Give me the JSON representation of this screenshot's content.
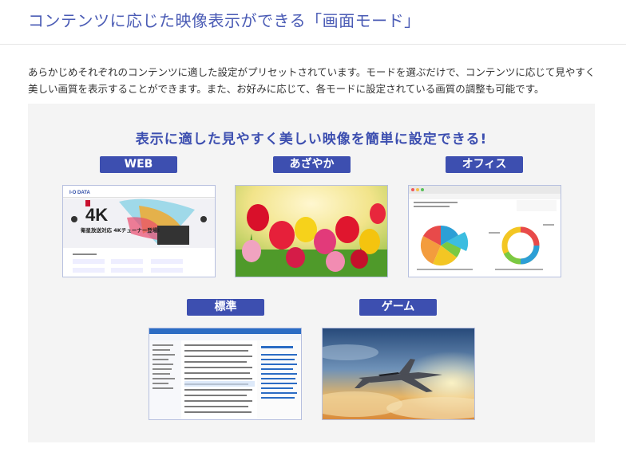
{
  "page": {
    "title": "コンテンツに応じた映像表示ができる「画面モード」",
    "intro": "あらかじめそれぞれのコンテンツに適した設定がプリセットされています。モードを選ぶだけで、コンテンツに応じて見やすく美しい画質を表示することができます。また、お好みに応じて、各モードに設定されている画質の調整も可能です。"
  },
  "panel": {
    "headline": "表示に適した見やすく美しい映像を簡単に設定できる!",
    "modes": [
      {
        "label": "WEB"
      },
      {
        "label": "あざやか"
      },
      {
        "label": "オフィス"
      },
      {
        "label": "標準"
      },
      {
        "label": "ゲーム"
      }
    ],
    "web_thumb": {
      "logo": "I-O DATA",
      "big_text": "4K",
      "sub_text": "衛星放送対応 4Kチューナー登場!"
    }
  },
  "colors": {
    "accent": "#3d4fb0",
    "title": "#4a5bb5",
    "panel_bg": "#f4f4f4"
  }
}
